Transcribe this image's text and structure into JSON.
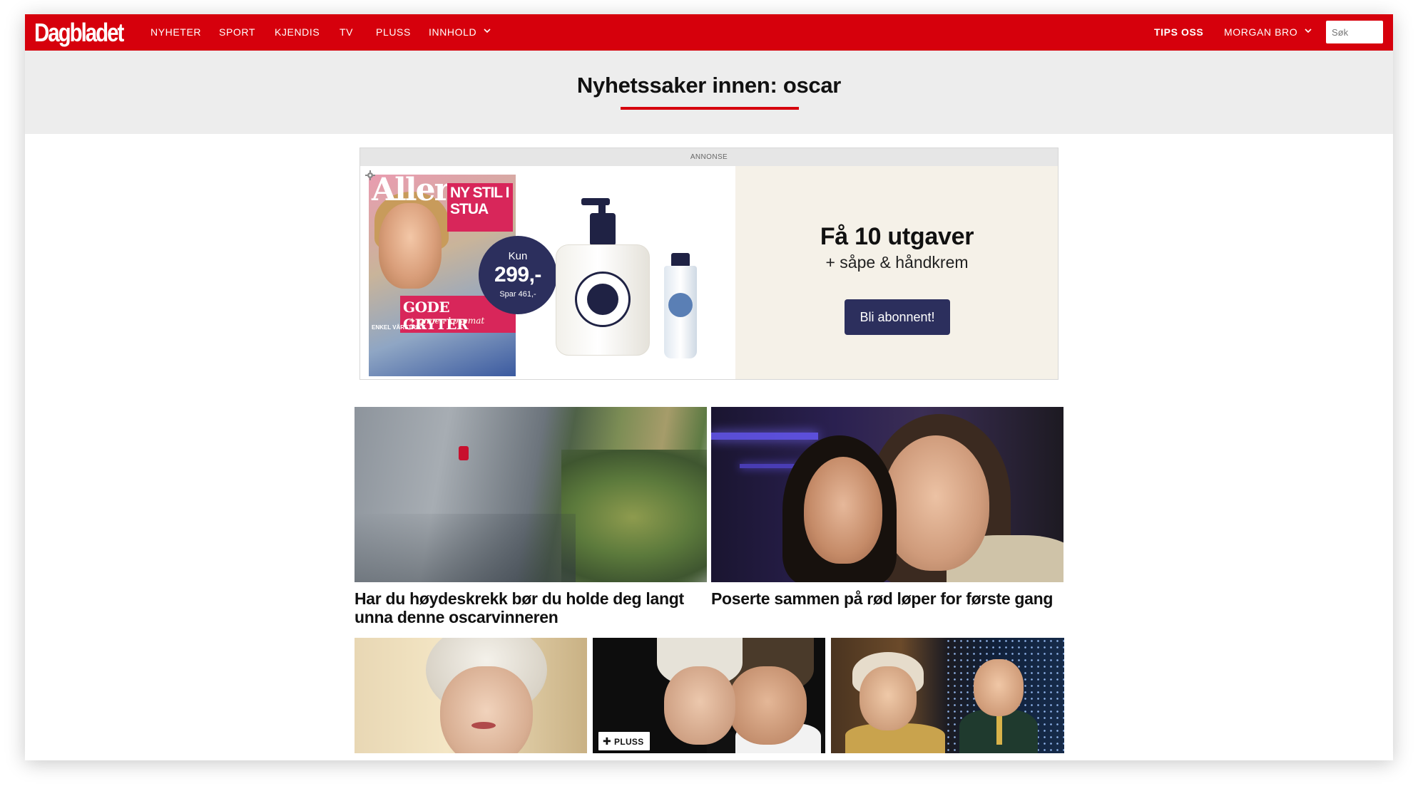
{
  "brand": {
    "name": "Dagbladet",
    "accent_color": "#d6000c",
    "header_bg": "#ededed"
  },
  "nav": {
    "items": [
      {
        "label": "NYHETER"
      },
      {
        "label": "SPORT"
      },
      {
        "label": "KJENDIS"
      },
      {
        "label": "TV"
      },
      {
        "label": "PLUSS"
      },
      {
        "label": "INNHOLD",
        "icon": "chevron-down-icon"
      }
    ],
    "tips_label": "TIPS OSS",
    "user_label": "MORGAN BRO",
    "user_icon": "chevron-down-icon",
    "search_placeholder": "Søk"
  },
  "page": {
    "title": "Nyhetssaker innen: oscar"
  },
  "ad": {
    "label": "ANNONSE",
    "headline": "Få 10 utgaver",
    "subline": "+ såpe & håndkrem",
    "cta": "Bli abonnent!",
    "cta_color": "#2c2f5d",
    "magazine_brand": "Allers",
    "magazine_headline_1": "NY STIL I STUA",
    "magazine_headline_2": "GODE GRYTER",
    "magazine_subline": "+ annen kosemat",
    "magazine_small": "ENKEL VÅRSTRIKK",
    "price_prefix": "Kun",
    "price": "299,-",
    "price_save": "Spar 461,-"
  },
  "articles": [
    {
      "title": "Har du høydeskrekk bør du holde deg langt unna denne oscarvinneren",
      "image": "climber-on-cliff"
    },
    {
      "title": "Poserte sammen på rød løper for første gang",
      "image": "two-women-red-carpet"
    },
    {
      "title": "",
      "image": "woman-platinum-hair"
    },
    {
      "title": "",
      "image": "couple-at-event",
      "badge": "PLUSS"
    },
    {
      "title": "",
      "image": "oscar-audience-and-winner"
    }
  ]
}
